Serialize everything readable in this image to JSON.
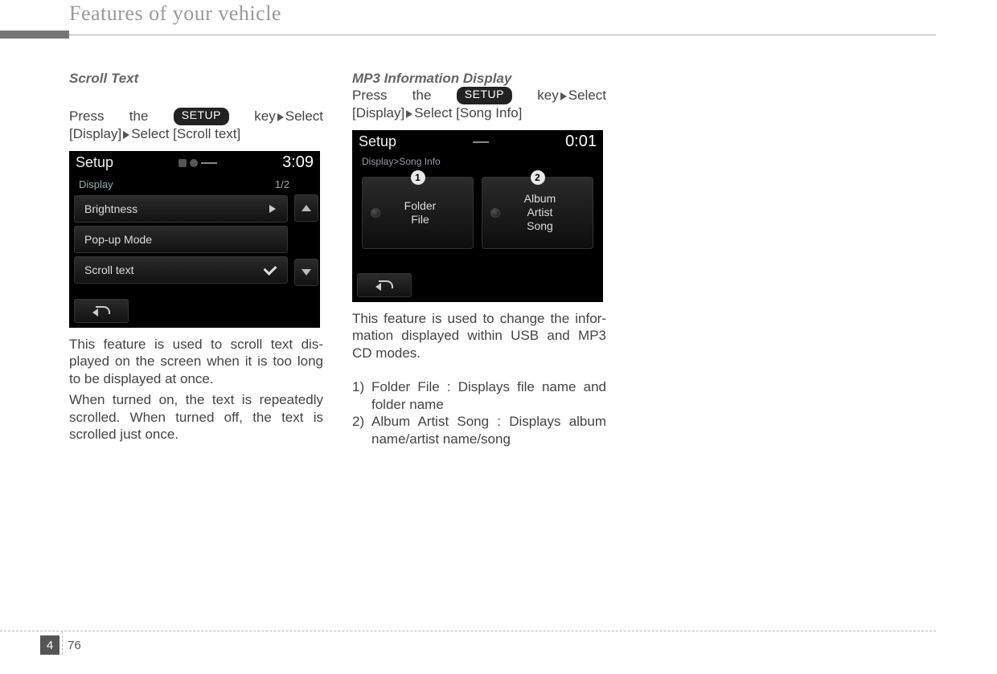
{
  "header": {
    "title": "Features of your vehicle"
  },
  "footer": {
    "chapter": "4",
    "page": "76"
  },
  "col1": {
    "heading": "Scroll Text",
    "line1_a": "Press",
    "line1_b": "the",
    "setup": "SETUP",
    "line1_c": "key",
    "line1_d": "Select",
    "line2_a": "[Display]",
    "line2_b": "Select [Scroll text]",
    "p1": "This feature is used to scroll text dis­played on the screen when it is too long to be displayed at once.",
    "p2": "When turned on, the text is repeatedly scrolled. When turned off, the text is scrolled just once.",
    "screen": {
      "title": "Setup",
      "time": "3:09",
      "subtitle": "Display",
      "page": "1/2",
      "items": [
        "Brightness",
        "Pop-up Mode",
        "Scroll text"
      ]
    }
  },
  "col2": {
    "heading": "MP3 Information Display",
    "line1_a": "Press",
    "line1_b": "the",
    "setup": "SETUP",
    "line1_c": "key",
    "line1_d": "Select",
    "line2_a": "[Display]",
    "line2_b": "Select [Song Info]",
    "p1": "This feature is used to change the infor­mation displayed within USB and MP3 CD modes.",
    "list": [
      {
        "n": "1)",
        "t": "Folder File : Displays file name and folder name"
      },
      {
        "n": "2)",
        "t": "Album Artist Song : Displays album name/artist name/song"
      }
    ],
    "screen": {
      "title": "Setup",
      "time": "0:01",
      "crumb": "Display>Song Info",
      "opt1": "Folder\nFile",
      "opt2": "Album\nArtist\nSong",
      "b1": "1",
      "b2": "2"
    }
  }
}
